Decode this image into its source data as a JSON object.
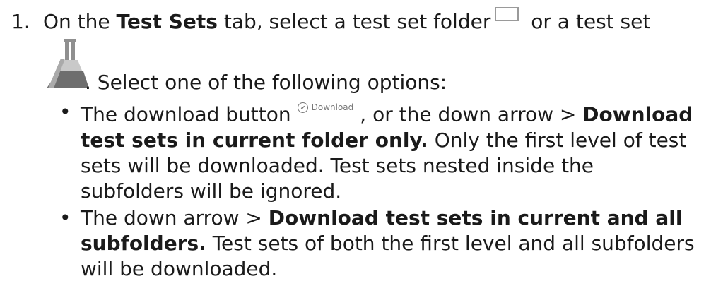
{
  "step": {
    "number": "1.",
    "line1_a": "On the ",
    "line1_bold": "Test Sets",
    "line1_b": " tab, select a test set folder",
    "line1_c": " or a test set",
    "line2": ". Select one of the following options:",
    "folder_icon": "folder-icon",
    "testset_icon": "flask-icon"
  },
  "options": [
    {
      "bullet": "•",
      "text_a": "The download button",
      "button_icon": "download-icon",
      "button_label": "Download",
      "text_b": ", or the down arrow > ",
      "bold": "Download test sets in current folder only.",
      "text_c": " Only the first level of test sets will be downloaded. Test sets nested inside the subfolders will be ignored."
    },
    {
      "bullet": "•",
      "text_a": "The down arrow > ",
      "bold": "Download test sets in current and all subfolders.",
      "text_c": " Test sets of both the first level and all subfolders will be downloaded."
    }
  ]
}
